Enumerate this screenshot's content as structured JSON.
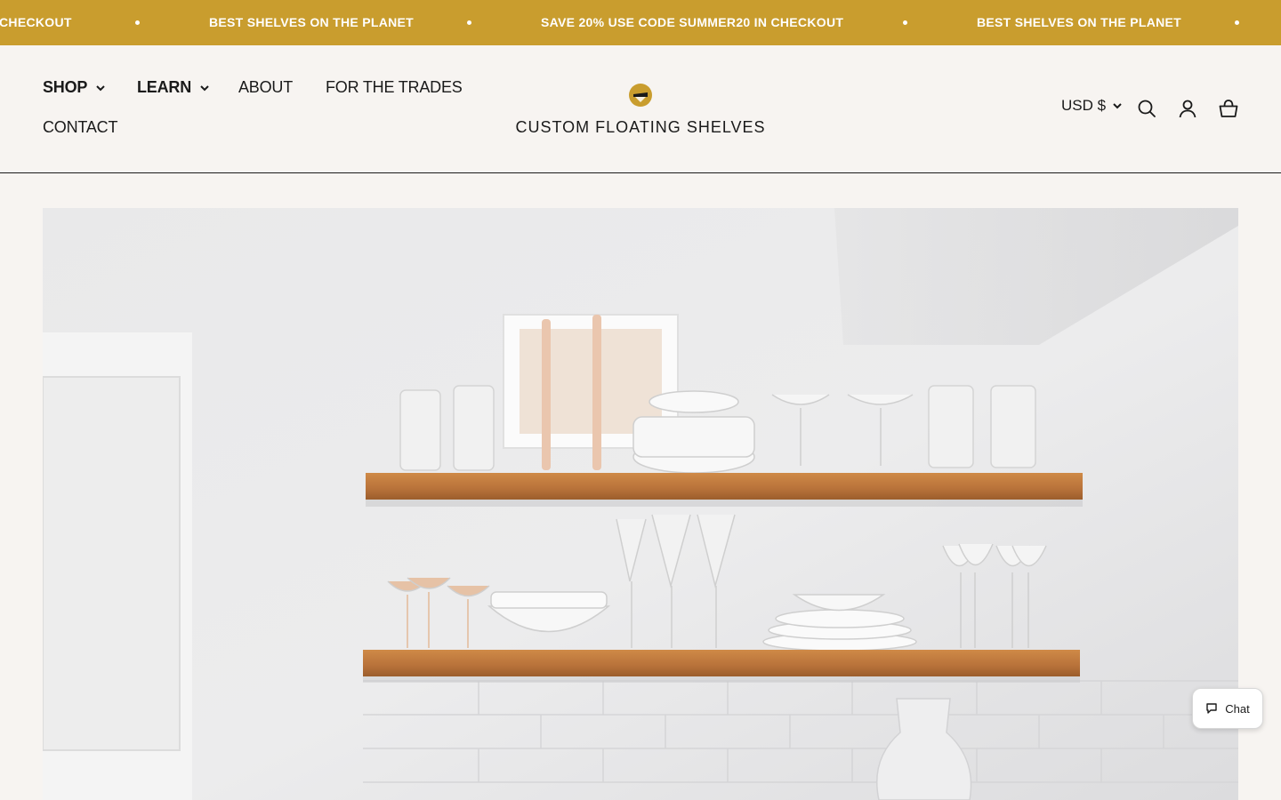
{
  "announcement": {
    "messages": [
      "CHECKOUT",
      "BEST SHELVES ON THE PLANET",
      "SAVE 20% USE CODE SUMMER20 IN CHECKOUT",
      "BEST SHELVES ON THE PLANET"
    ]
  },
  "nav": {
    "shop": "SHOP",
    "learn": "LEARN",
    "about": "ABOUT",
    "trades": "FOR THE TRADES",
    "contact": "CONTACT"
  },
  "logo": {
    "name": "CUSTOM FLOATING SHELVES"
  },
  "header_tools": {
    "currency": "USD $",
    "icons": [
      "search-icon",
      "account-icon",
      "cart-icon"
    ]
  },
  "chat": {
    "label": "Chat",
    "icon": "chat-bubble-icon"
  },
  "colors": {
    "announcement_bg": "#c99d2e",
    "page_bg": "#f7f4f1",
    "text": "#1a1a1a",
    "shelf_wood": "#c07c3e"
  }
}
